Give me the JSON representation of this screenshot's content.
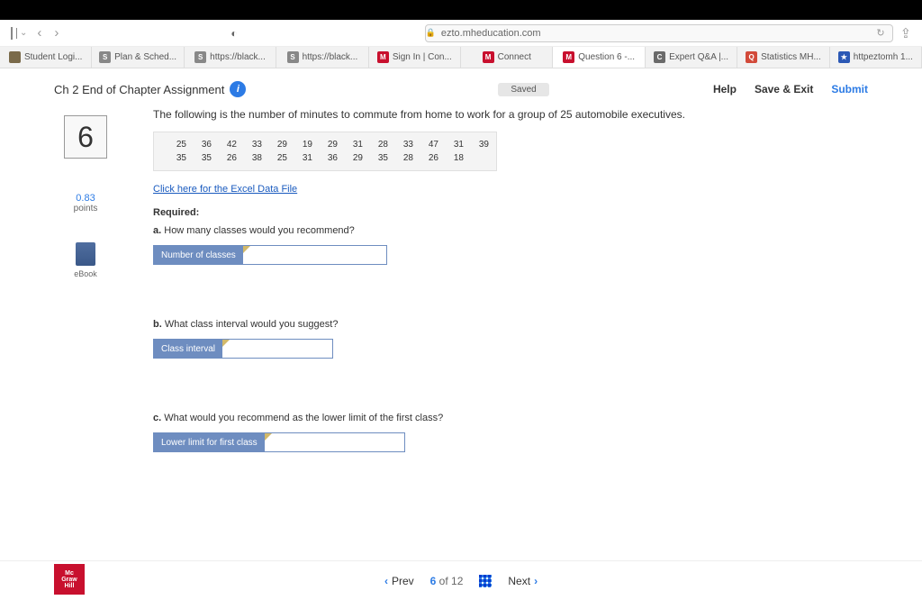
{
  "browser": {
    "url": "ezto.mheducation.com",
    "tabs": [
      {
        "label": "Student Logi...",
        "color": "#7a6a4a"
      },
      {
        "label": "Plan & Sched...",
        "favtext": "S",
        "color": "#888"
      },
      {
        "label": "https://black...",
        "favtext": "S",
        "color": "#888"
      },
      {
        "label": "https://black...",
        "favtext": "S",
        "color": "#888"
      },
      {
        "label": "Sign In | Con...",
        "favtext": "M",
        "color": "#c8102e"
      },
      {
        "label": "Connect",
        "favtext": "M",
        "color": "#c8102e"
      },
      {
        "label": "Question 6 -...",
        "favtext": "M",
        "color": "#c8102e",
        "active": true
      },
      {
        "label": "Expert Q&A |...",
        "favtext": "C",
        "color": "#6a6a6a"
      },
      {
        "label": "Statistics MH...",
        "favtext": "Q",
        "color": "#d24a3a"
      },
      {
        "label": "httpeztomh 1...",
        "favtext": "",
        "color": "#2b58b5"
      }
    ]
  },
  "header": {
    "title": "Ch 2 End of Chapter Assignment",
    "status": "Saved",
    "help": "Help",
    "saveexit": "Save & Exit",
    "submit": "Submit"
  },
  "question": {
    "number": "6",
    "points_value": "0.83",
    "points_label": "points",
    "ebook": "eBook",
    "stem": "The following is the number of minutes to commute from home to work for a group of 25 automobile executives.",
    "data_row1": [
      "25",
      "36",
      "42",
      "33",
      "29",
      "19",
      "29",
      "31",
      "28",
      "33",
      "47",
      "31",
      "39"
    ],
    "data_row2": [
      "35",
      "35",
      "26",
      "38",
      "25",
      "31",
      "36",
      "29",
      "35",
      "28",
      "26",
      "18",
      ""
    ],
    "excel_link": "Click here for the Excel Data File",
    "required": "Required:",
    "parts": {
      "a": {
        "letter": "a.",
        "text": "How many classes would you recommend?",
        "label": "Number of classes"
      },
      "b": {
        "letter": "b.",
        "text": "What class interval would you suggest?",
        "label": "Class interval"
      },
      "c": {
        "letter": "c.",
        "text": "What would you recommend as the lower limit of the first class?",
        "label": "Lower limit for first class"
      }
    }
  },
  "footer": {
    "prev": "Prev",
    "next": "Next",
    "current": "6",
    "of": "of",
    "total": "12",
    "logo_l1": "Mc",
    "logo_l2": "Graw",
    "logo_l3": "Hill"
  }
}
